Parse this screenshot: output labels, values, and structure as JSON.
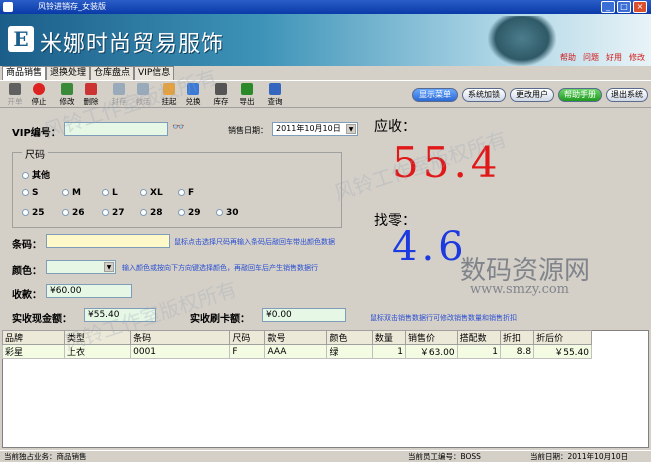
{
  "window": {
    "title": "风铃进销存_女装版"
  },
  "banner": {
    "logo_text": "E",
    "company": "米娜时尚贸易服饰",
    "links": [
      "帮助",
      "问题",
      "好用",
      "修改"
    ]
  },
  "tabs": [
    "商品销售",
    "退换处理",
    "仓库盘点",
    "VIP信息"
  ],
  "toolbar": {
    "items": [
      "开单",
      "停止",
      "修改",
      "删除",
      "封存",
      "救活",
      "挂起",
      "兑换",
      "库存",
      "导出",
      "查询"
    ]
  },
  "right_buttons": [
    "显示菜单",
    "系统加锁",
    "更改用户",
    "帮助手册",
    "退出系统"
  ],
  "form": {
    "vip_label": "VIP编号：",
    "vip_value": "",
    "vip_search_icon": "binoculars-icon",
    "vip_search_glyph": "👓",
    "date_label": "销售日期：",
    "date_value": "2011年10月10日",
    "size_legend": "尺码",
    "size_other": "其他",
    "sizes_row1": [
      "S",
      "M",
      "L",
      "XL",
      "F"
    ],
    "sizes_row2": [
      "25",
      "26",
      "27",
      "28",
      "29",
      "30"
    ],
    "barcode_label": "条码：",
    "barcode_value": "",
    "barcode_hint": "鼠标点击选择尺码再输入条码后敲回车带出颜色数据",
    "color_label": "颜色：",
    "color_value": "",
    "color_hint": "输入颜色或按向下方向键选择颜色，再敲回车后产生销售数据行",
    "received_label": "收款：",
    "received_value": "¥60.00",
    "cash_label": "实收现金额：",
    "cash_value": "¥55.40",
    "card_label": "实收刷卡额：",
    "card_value": "¥0.00",
    "bottom_hint": "鼠标双击销售数据行可修改销售数量和销售折扣"
  },
  "summary": {
    "due_label": "应收：",
    "due_value": "55.4",
    "change_label": "找零：",
    "change_value": "4.6"
  },
  "table": {
    "headers": [
      "品牌",
      "类型",
      "条码",
      "尺码",
      "款号",
      "颜色",
      "数量",
      "销售价",
      "搭配数",
      "折扣",
      "折后价"
    ],
    "rows": [
      [
        "彩星",
        "上衣",
        "0001",
        "F",
        "AAA",
        "绿",
        "1",
        "￥63.00",
        "1",
        "8.8",
        "￥55.40"
      ]
    ]
  },
  "statusbar": {
    "left": "当前独占业务：商品销售",
    "mid": "当前员工编号：BOSS",
    "right": "当前日期：2011年10月10日"
  },
  "watermarks": [
    "风铃工作室版权所有",
    "风铃工作室版权所有",
    "风铃工作室版权所有",
    "数码资源网",
    "www.smzy.com"
  ],
  "colors": {
    "accent": "#1b5e8a",
    "due": "#e01818",
    "change": "#1c3ae0",
    "highlight": "#2c6ad4"
  }
}
